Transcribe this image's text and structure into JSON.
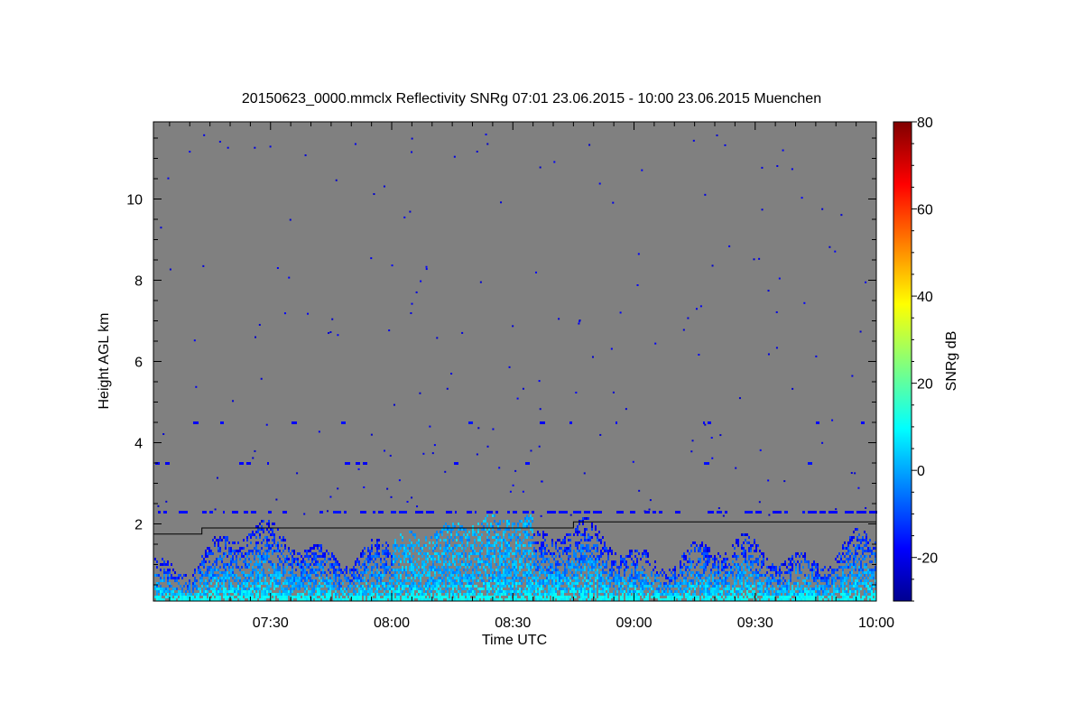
{
  "chart_data": {
    "type": "heatmap",
    "title": "20150623_0000.mmclx Reflectivity SNRg   07:01 23.06.2015 - 10:00 23.06.2015 Muenchen",
    "xlabel": "Time UTC",
    "ylabel": "Height AGL km",
    "colorbar_label": "SNRg dB",
    "x_range": [
      "07:01",
      "10:00"
    ],
    "y_range": [
      0.1,
      11.9
    ],
    "c_range": [
      -30,
      80
    ],
    "x_ticks": [
      "07:30",
      "08:00",
      "08:30",
      "09:00",
      "09:30",
      "10:00"
    ],
    "y_ticks": [
      "2",
      "4",
      "6",
      "8",
      "10"
    ],
    "c_ticks": [
      "-20",
      "0",
      "20",
      "40",
      "60",
      "80"
    ],
    "colormap": "jet",
    "background_color": "#808080",
    "features": [
      {
        "name": "boundary layer echoes",
        "y_range": [
          0.1,
          2.3
        ],
        "snr_range": [
          -25,
          12
        ]
      },
      {
        "name": "strongest convective plumes",
        "x_range": [
          "08:00",
          "08:35"
        ],
        "y_top": 2.2
      },
      {
        "name": "interference line",
        "y": 2.3
      },
      {
        "name": "interference line",
        "y": 3.5
      },
      {
        "name": "interference line",
        "y": 4.5
      }
    ],
    "overlay_line": {
      "color": "#000000",
      "points": [
        {
          "x": "07:01",
          "y": 1.75
        },
        {
          "x": "07:13",
          "y": 1.75
        },
        {
          "x": "07:13",
          "y": 1.9
        },
        {
          "x": "08:45",
          "y": 1.9
        },
        {
          "x": "08:45",
          "y": 2.05
        },
        {
          "x": "10:00",
          "y": 2.05
        }
      ]
    }
  }
}
